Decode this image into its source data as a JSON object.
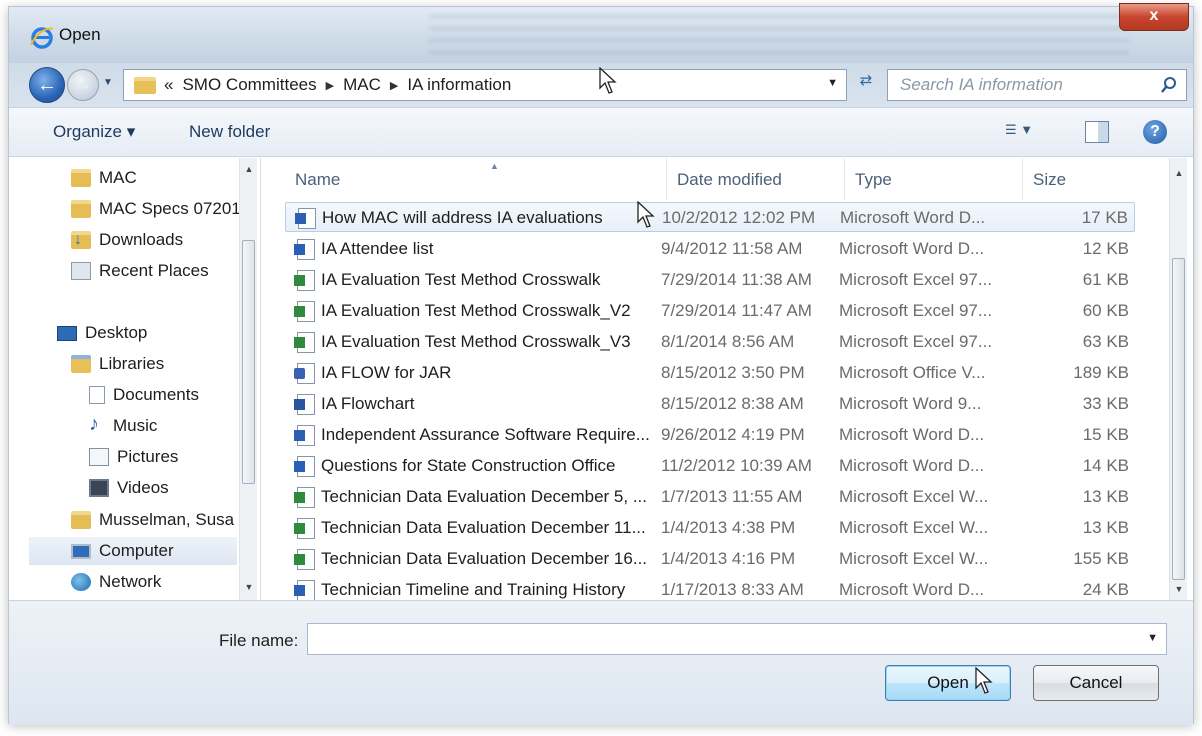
{
  "window": {
    "title": "Open",
    "close_label": "x"
  },
  "address": {
    "crumb_prefix": "«",
    "crumbs": [
      "SMO Committees",
      "MAC",
      "IA information"
    ]
  },
  "search": {
    "placeholder": "Search IA information"
  },
  "toolbar": {
    "organize_label": "Organize ▾",
    "new_folder_label": "New folder",
    "help_label": "?"
  },
  "navpane": {
    "items": [
      {
        "label": "MAC",
        "icon": "folder-icon"
      },
      {
        "label": "MAC Specs 07201",
        "icon": "folder-icon"
      },
      {
        "label": "Downloads",
        "icon": "downloads-icon"
      },
      {
        "label": "Recent Places",
        "icon": "recent-places-icon"
      },
      {
        "label": "Desktop",
        "icon": "desktop-icon"
      },
      {
        "label": "Libraries",
        "icon": "libraries-icon"
      },
      {
        "label": "Documents",
        "icon": "documents-icon"
      },
      {
        "label": "Music",
        "icon": "music-icon"
      },
      {
        "label": "Pictures",
        "icon": "pictures-icon"
      },
      {
        "label": "Videos",
        "icon": "videos-icon"
      },
      {
        "label": "Musselman, Susa",
        "icon": "user-folder-icon"
      },
      {
        "label": "Computer",
        "icon": "computer-icon"
      },
      {
        "label": "Network",
        "icon": "network-icon"
      }
    ]
  },
  "filelist": {
    "columns": {
      "name": "Name",
      "date": "Date modified",
      "type": "Type",
      "size": "Size"
    },
    "rows": [
      {
        "name": "How MAC will address IA evaluations",
        "date": "10/2/2012 12:02 PM",
        "type": "Microsoft Word D...",
        "size": "17 KB",
        "icon": "word-doc-icon"
      },
      {
        "name": "IA Attendee list",
        "date": "9/4/2012 11:58 AM",
        "type": "Microsoft Word D...",
        "size": "12 KB",
        "icon": "word-doc-icon"
      },
      {
        "name": "IA Evaluation Test Method Crosswalk",
        "date": "7/29/2014 11:38 AM",
        "type": "Microsoft Excel 97...",
        "size": "61 KB",
        "icon": "excel-97-icon"
      },
      {
        "name": "IA Evaluation Test Method Crosswalk_V2",
        "date": "7/29/2014 11:47 AM",
        "type": "Microsoft Excel 97...",
        "size": "60 KB",
        "icon": "excel-97-icon"
      },
      {
        "name": "IA Evaluation Test Method Crosswalk_V3",
        "date": "8/1/2014 8:56 AM",
        "type": "Microsoft Excel 97...",
        "size": "63 KB",
        "icon": "excel-97-icon"
      },
      {
        "name": "IA FLOW for JAR",
        "date": "8/15/2012 3:50 PM",
        "type": "Microsoft Office V...",
        "size": "189 KB",
        "icon": "visio-icon"
      },
      {
        "name": "IA Flowchart",
        "date": "8/15/2012 8:38 AM",
        "type": "Microsoft Word 9...",
        "size": "33 KB",
        "icon": "word-97-icon"
      },
      {
        "name": "Independent Assurance Software Require...",
        "date": "9/26/2012 4:19 PM",
        "type": "Microsoft Word D...",
        "size": "15 KB",
        "icon": "word-doc-icon"
      },
      {
        "name": "Questions for State Construction Office",
        "date": "11/2/2012 10:39 AM",
        "type": "Microsoft Word D...",
        "size": "14 KB",
        "icon": "word-doc-icon"
      },
      {
        "name": "Technician Data Evaluation December 5, ...",
        "date": "1/7/2013 11:55 AM",
        "type": "Microsoft Excel W...",
        "size": "13 KB",
        "icon": "excel-workbook-icon"
      },
      {
        "name": "Technician Data Evaluation December 11...",
        "date": "1/4/2013 4:38 PM",
        "type": "Microsoft Excel W...",
        "size": "13 KB",
        "icon": "excel-workbook-icon"
      },
      {
        "name": "Technician Data Evaluation December 16...",
        "date": "1/4/2013 4:16 PM",
        "type": "Microsoft Excel W...",
        "size": "155 KB",
        "icon": "excel-workbook-icon"
      },
      {
        "name": "Technician Timeline and Training History",
        "date": "1/17/2013 8:33 AM",
        "type": "Microsoft Word D...",
        "size": "24 KB",
        "icon": "word-doc-icon"
      }
    ]
  },
  "bottom": {
    "file_name_label": "File name:",
    "file_name_value": "",
    "open_label": "Open",
    "cancel_label": "Cancel"
  }
}
